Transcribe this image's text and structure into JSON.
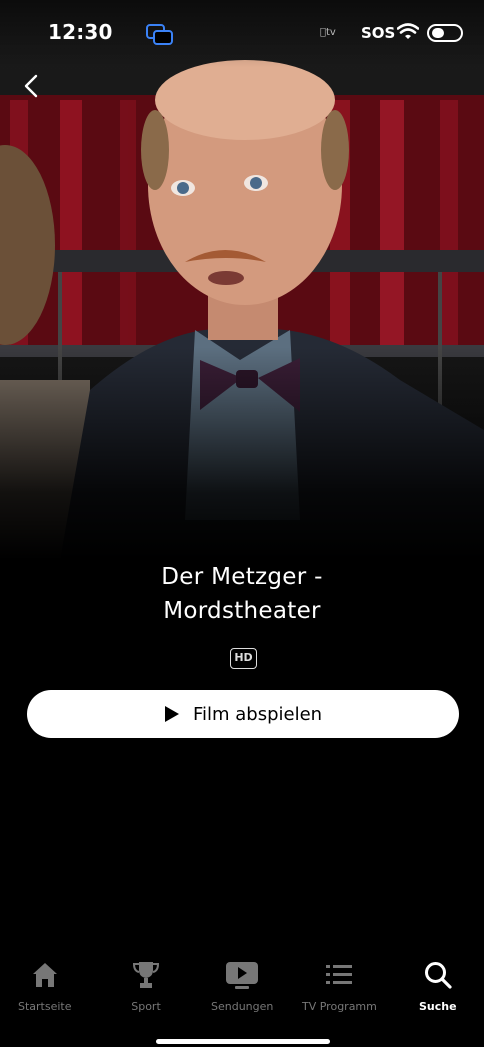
{
  "status_bar": {
    "time": "12:30",
    "tv_label": "tv",
    "sos_label": "SOS"
  },
  "movie": {
    "title_line1": "Der Metzger -",
    "title_line2": "Mordstheater",
    "quality_badge": "HD",
    "play_label": "Film abspielen"
  },
  "tab_bar": {
    "items": [
      {
        "label": "Startseite",
        "icon": "home-icon",
        "active": false
      },
      {
        "label": "Sport",
        "icon": "trophy-icon",
        "active": false
      },
      {
        "label": "Sendungen",
        "icon": "play-box-icon",
        "active": false
      },
      {
        "label": "TV Programm",
        "icon": "list-icon",
        "active": false
      },
      {
        "label": "Suche",
        "icon": "search-icon",
        "active": true
      }
    ]
  },
  "colors": {
    "background": "#000000",
    "accent": "#ffffff",
    "inactive_tab": "#777777",
    "cast_icon": "#3b82f6"
  }
}
